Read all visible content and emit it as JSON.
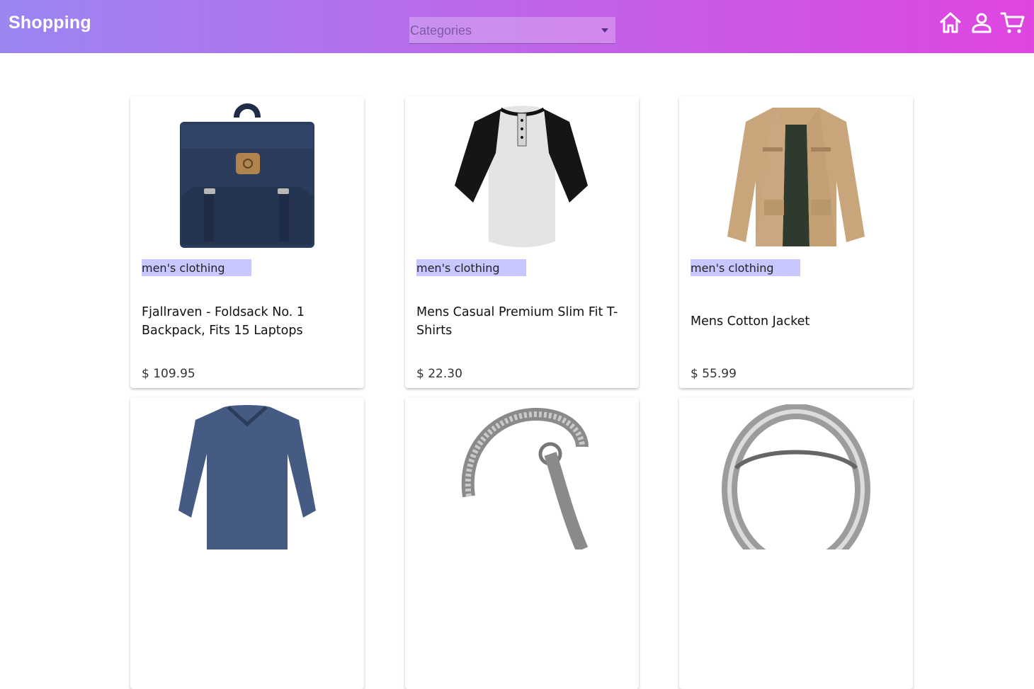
{
  "header": {
    "brand": "Shopping",
    "category_select": {
      "selected": "Categories"
    },
    "icons": [
      "home-icon",
      "account-icon",
      "cart-icon"
    ]
  },
  "colors": {
    "gradient_start": "#9b86f0",
    "gradient_end": "#df45e0",
    "chip": "#c8c7ff"
  },
  "products": [
    {
      "category": "men's clothing",
      "title": "Fjallraven - Foldsack No. 1 Backpack, Fits 15 Laptops",
      "price": "$ 109.95",
      "image": "backpack"
    },
    {
      "category": "men's clothing",
      "title": "Mens Casual Premium Slim Fit T-Shirts",
      "price": "$ 22.30",
      "image": "t-shirt"
    },
    {
      "category": "men's clothing",
      "title": "Mens Cotton Jacket",
      "price": "$ 55.99",
      "image": "jacket"
    },
    {
      "image": "long-sleeve-shirt"
    },
    {
      "image": "bracelet"
    },
    {
      "image": "ring"
    }
  ]
}
